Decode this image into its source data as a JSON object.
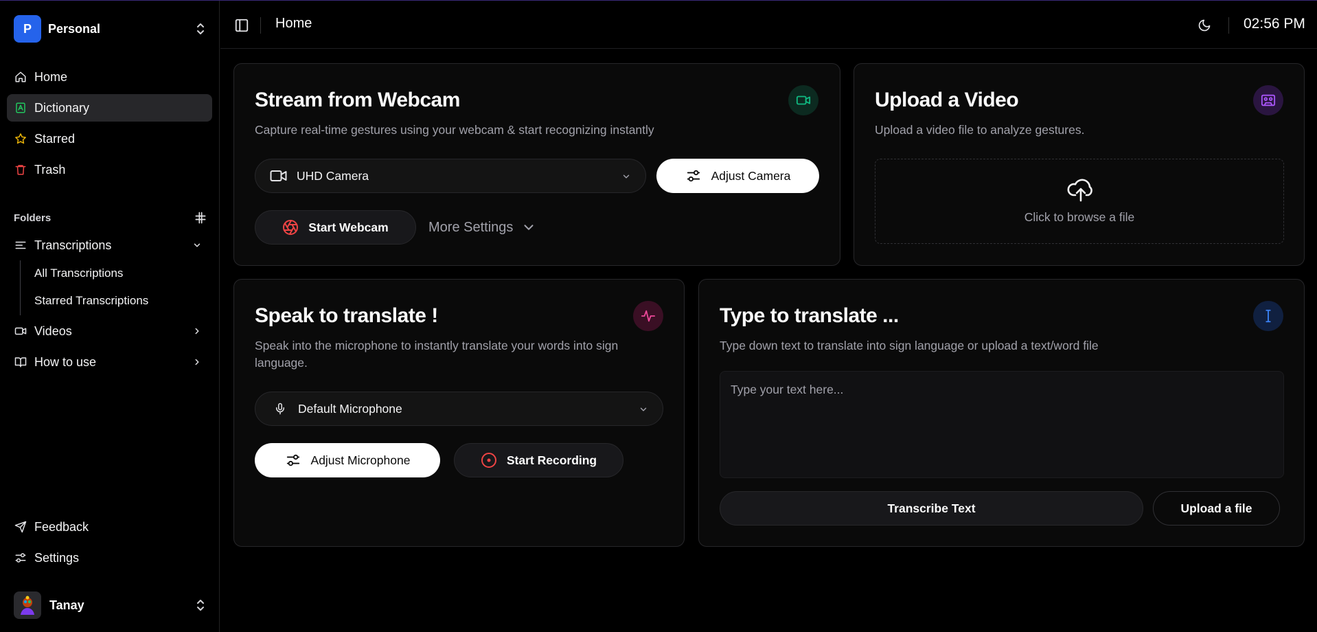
{
  "workspace": {
    "name": "Personal",
    "initial": "P"
  },
  "nav": {
    "home": "Home",
    "dictionary": "Dictionary",
    "starred": "Starred",
    "trash": "Trash"
  },
  "folders": {
    "header": "Folders",
    "transcriptions": "Transcriptions",
    "all_transcriptions": "All Transcriptions",
    "starred_transcriptions": "Starred Transcriptions",
    "videos": "Videos",
    "how_to_use": "How to use"
  },
  "footer_nav": {
    "feedback": "Feedback",
    "settings": "Settings"
  },
  "user": {
    "name": "Tanay"
  },
  "topbar": {
    "title": "Home",
    "time": "02:56 PM"
  },
  "webcam_card": {
    "title": "Stream from Webcam",
    "description": "Capture real-time gestures using your webcam & start recognizing instantly",
    "camera_select": "UHD Camera",
    "adjust_button": "Adjust Camera",
    "start_button": "Start Webcam",
    "more_settings": "More Settings",
    "icon_color": "#10b981"
  },
  "upload_card": {
    "title": "Upload a Video",
    "description": "Upload a video file to analyze gestures.",
    "dropzone_text": "Click to browse a file",
    "icon_color": "#a855f7"
  },
  "speak_card": {
    "title": "Speak to translate !",
    "description": "Speak into the microphone to instantly translate your words into sign language.",
    "mic_select": "Default Microphone",
    "adjust_button": "Adjust Microphone",
    "record_button": "Start Recording",
    "icon_color": "#ec4899"
  },
  "type_card": {
    "title": "Type to translate ...",
    "description": "Type down text to translate into sign language or upload a text/word file",
    "placeholder": "Type your text here...",
    "transcribe_button": "Transcribe Text",
    "upload_button": "Upload a file",
    "icon_color": "#3b82f6"
  }
}
